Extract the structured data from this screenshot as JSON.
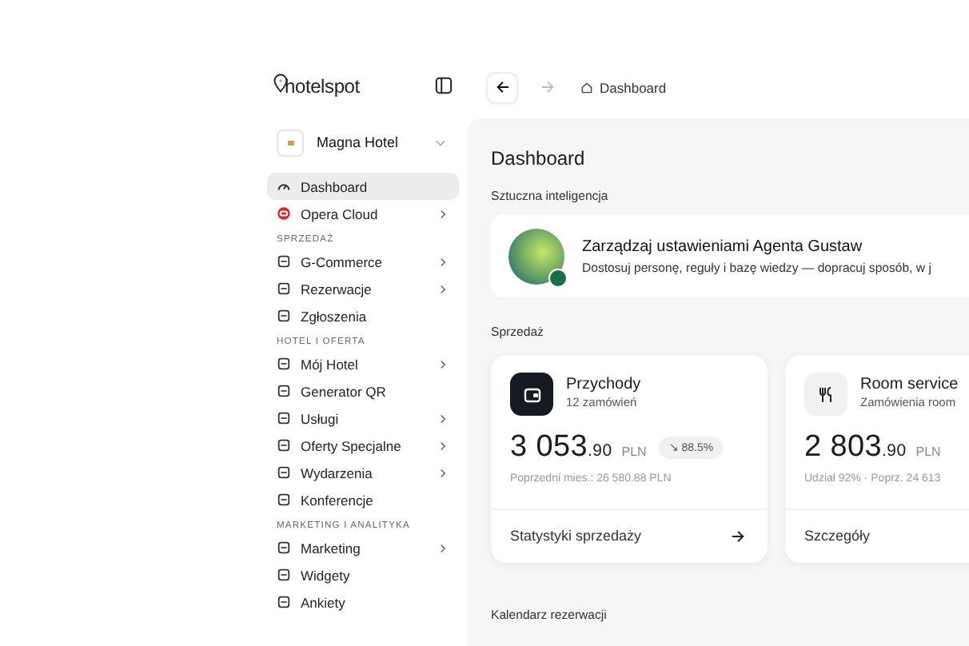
{
  "brand": {
    "name": "hotelspot"
  },
  "hotel_picker": {
    "name": "Magna Hotel"
  },
  "sidebar": {
    "items": [
      {
        "kind": "item",
        "label": "Dashboard",
        "selected": true,
        "has_submenu": false
      },
      {
        "kind": "item",
        "label": "Opera Cloud",
        "selected": false,
        "has_submenu": true
      },
      {
        "kind": "section",
        "label": "SPRZEDAŻ"
      },
      {
        "kind": "item",
        "label": "G-Commerce",
        "selected": false,
        "has_submenu": true
      },
      {
        "kind": "item",
        "label": "Rezerwacje",
        "selected": false,
        "has_submenu": true
      },
      {
        "kind": "item",
        "label": "Zgłoszenia",
        "selected": false,
        "has_submenu": false
      },
      {
        "kind": "section",
        "label": "HOTEL I OFERTA"
      },
      {
        "kind": "item",
        "label": "Mój Hotel",
        "selected": false,
        "has_submenu": true
      },
      {
        "kind": "item",
        "label": "Generator QR",
        "selected": false,
        "has_submenu": false
      },
      {
        "kind": "item",
        "label": "Usługi",
        "selected": false,
        "has_submenu": true
      },
      {
        "kind": "item",
        "label": "Oferty Specjalne",
        "selected": false,
        "has_submenu": true
      },
      {
        "kind": "item",
        "label": "Wydarzenia",
        "selected": false,
        "has_submenu": true
      },
      {
        "kind": "item",
        "label": "Konferencje",
        "selected": false,
        "has_submenu": false
      },
      {
        "kind": "section",
        "label": "MARKETING I ANALITYKA"
      },
      {
        "kind": "item",
        "label": "Marketing",
        "selected": false,
        "has_submenu": true
      },
      {
        "kind": "item",
        "label": "Widgety",
        "selected": false,
        "has_submenu": false
      },
      {
        "kind": "item",
        "label": "Ankiety",
        "selected": false,
        "has_submenu": false
      }
    ]
  },
  "breadcrumb": {
    "label": "Dashboard"
  },
  "page": {
    "title": "Dashboard",
    "ai_section": {
      "heading": "Sztuczna inteligencja",
      "title": "Zarządzaj ustawieniami Agenta Gustaw",
      "description": "Dostosuj personę, reguły i bazę wiedzy — dopracuj sposób, w j"
    },
    "sales_section": {
      "heading": "Sprzedaż",
      "cards": [
        {
          "title": "Przychody",
          "subtitle": "12 zamówień",
          "amount": "3 053",
          "decimals": ".90",
          "currency": "PLN",
          "change": "↘ 88.5%",
          "note": "Poprzedni mies.: 26 580.88 PLN",
          "link": "Statystyki sprzedaży",
          "dark_icon": true
        },
        {
          "title": "Room service",
          "subtitle": "Zamówienia room",
          "amount": "2 803",
          "decimals": ".90",
          "currency": "PLN",
          "note": "Udział 92% · Poprz. 24 613",
          "link": "Szczegóły",
          "dark_icon": false
        }
      ]
    },
    "calendar_section": {
      "heading": "Kalendarz rezerwacji"
    }
  }
}
